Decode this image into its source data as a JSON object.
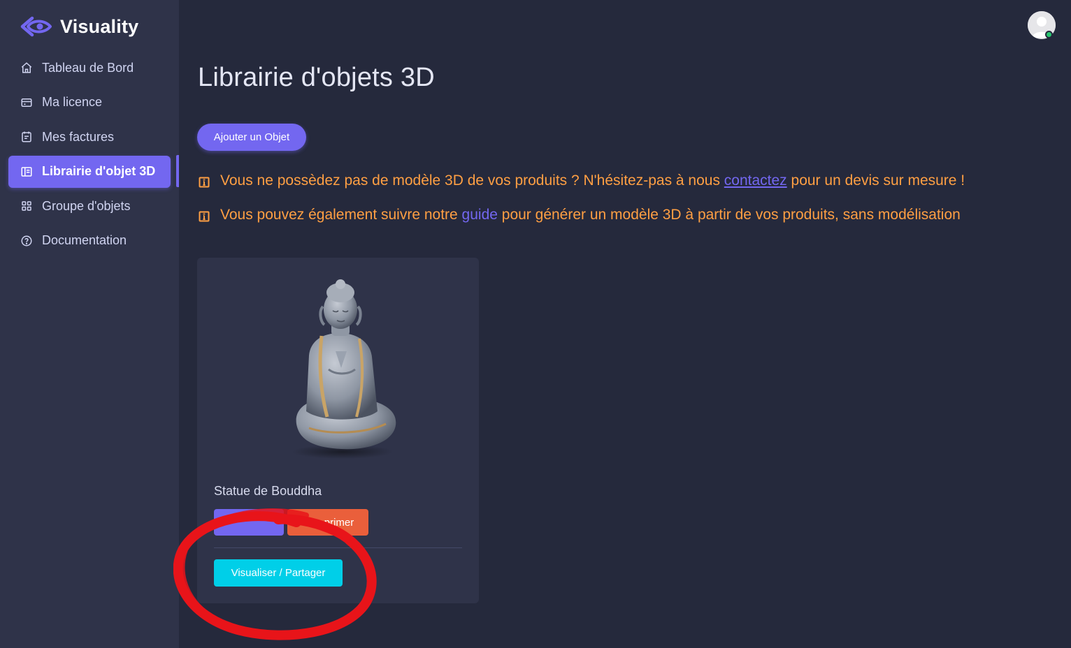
{
  "brand": {
    "name": "Visuality",
    "accent_color": "#7367f0"
  },
  "sidebar": {
    "items": [
      {
        "label": "Tableau de Bord",
        "icon": "home-icon",
        "active": false
      },
      {
        "label": "Ma licence",
        "icon": "credit-card-icon",
        "active": false
      },
      {
        "label": "Mes factures",
        "icon": "invoice-icon",
        "active": false
      },
      {
        "label": "Librairie d'objet 3D",
        "icon": "library-icon",
        "active": true
      },
      {
        "label": "Groupe d'objets",
        "icon": "grid-icon",
        "active": false
      },
      {
        "label": "Documentation",
        "icon": "help-circle-icon",
        "active": false
      }
    ]
  },
  "header": {
    "avatar_icon": "user-avatar-icon",
    "status_color": "#28c76f"
  },
  "main": {
    "title": "Librairie d'objets 3D",
    "add_button_label": "Ajouter un Objet",
    "notice_color": "#ff9f43",
    "notices": [
      {
        "before": "Vous ne possèdez pas de modèle 3D de vos produits ? N'hésitez-pas à nous ",
        "link": "contactez",
        "after": " pour un devis sur mesure !"
      },
      {
        "before": "Vous pouvez également suivre notre ",
        "link": "guide",
        "after": " pour générer un modèle 3D à partir de vos produits, sans modélisation"
      }
    ],
    "objects": [
      {
        "title": "Statue de Bouddha",
        "image": "buddha-statue-thumbnail",
        "delete_label_visible": "primer",
        "share_label": "Visualiser / Partager"
      }
    ]
  },
  "annotation": {
    "shape": "hand-drawn red circle around share button",
    "color": "#e8141a"
  }
}
